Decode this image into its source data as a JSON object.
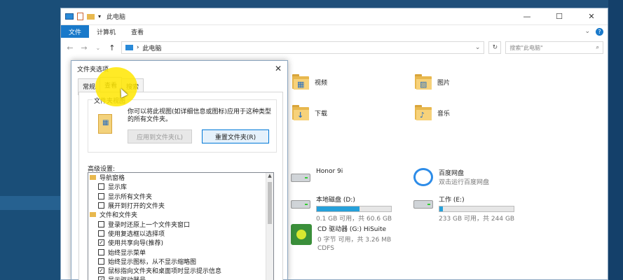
{
  "window": {
    "title": "此电脑",
    "controls": [
      "—",
      "☐",
      "✕"
    ],
    "ribbon_tabs": [
      "文件",
      "计算机",
      "查看"
    ],
    "ribbon_controls": [
      "⌄",
      "?"
    ]
  },
  "address": {
    "path": "此电脑",
    "search_placeholder": "搜索\"此电脑\""
  },
  "folders": [
    {
      "name": "视频",
      "glyph": "▦"
    },
    {
      "name": "图片",
      "glyph": "▨"
    },
    {
      "name": "下载",
      "glyph": "↓"
    },
    {
      "name": "音乐",
      "glyph": "♪"
    }
  ],
  "devices": [
    {
      "name": "Honor 9i",
      "sub": ""
    },
    {
      "name": "百度网盘",
      "sub": "双击运行百度网盘"
    }
  ],
  "drives": [
    {
      "name": "本地磁盘 (D:)",
      "free": "0.1 GB 可用，共 60.6 GB",
      "used_fraction": 0.58
    },
    {
      "name": "工作 (E:)",
      "free": "233 GB 可用，共 244 GB",
      "used_fraction": 0.05
    }
  ],
  "cd_drive": {
    "name": "CD 驱动器 (G:) HiSuite",
    "free": "0 字节 可用，共 3.26 MB",
    "fs": "CDFS"
  },
  "dialog": {
    "title": "文件夹选项",
    "close": "✕",
    "tabs": [
      "常规",
      "查看",
      "搜索"
    ],
    "folder_view_legend": "文件夹视图",
    "folder_view_desc": "你可以将此视图(如详细信息或图标)应用于这种类型的所有文件夹。",
    "apply_button": "应用到文件夹(L)",
    "reset_button": "重置文件夹(R)",
    "advanced_label": "高级设置:",
    "tree": [
      {
        "type": "group",
        "label": "导航窗格"
      },
      {
        "type": "item",
        "label": "显示库",
        "checked": false
      },
      {
        "type": "item",
        "label": "显示所有文件夹",
        "checked": false
      },
      {
        "type": "item",
        "label": "展开到打开的文件夹",
        "checked": false
      },
      {
        "type": "group",
        "label": "文件和文件夹"
      },
      {
        "type": "item",
        "label": "登录时还原上一个文件夹窗口",
        "checked": false
      },
      {
        "type": "item",
        "label": "使用复选框以选择项",
        "checked": false
      },
      {
        "type": "item",
        "label": "使用共享向导(推荐)",
        "checked": true
      },
      {
        "type": "item",
        "label": "始终显示菜单",
        "checked": false
      },
      {
        "type": "item",
        "label": "始终显示图标，从不显示缩略图",
        "checked": false
      },
      {
        "type": "item",
        "label": "鼠标指向文件夹和桌面项时显示提示信息",
        "checked": true
      },
      {
        "type": "item",
        "label": "显示驱动器号",
        "checked": true
      }
    ]
  },
  "colors": {
    "accent": "#1979ca",
    "drive_bar": "#26a0da",
    "highlight": "#ffe600"
  }
}
